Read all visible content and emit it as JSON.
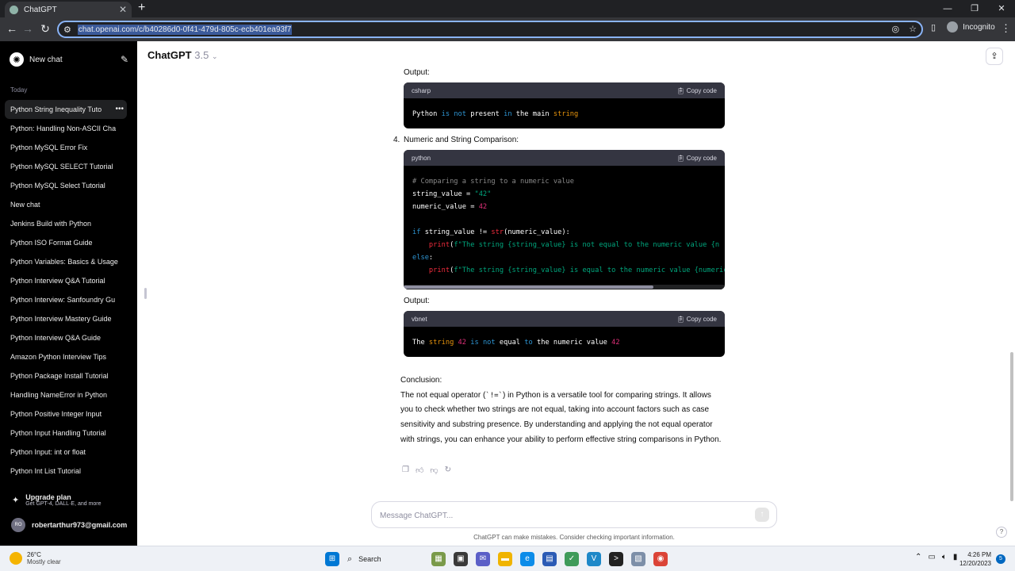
{
  "browser": {
    "tab_title": "ChatGPT",
    "url": "chat.openai.com/c/b40286d0-0f41-479d-805c-ecb401ea93f7",
    "incognito_label": "Incognito"
  },
  "sidebar": {
    "new_chat_label": "New chat",
    "section_today": "Today",
    "items": [
      "Python String Inequality Tuto",
      "Python: Handling Non-ASCII Cha",
      "Python MySQL Error Fix",
      "Python MySQL SELECT Tutorial",
      "Python MySQL Select Tutorial",
      "New chat",
      "Jenkins Build with Python",
      "Python ISO Format Guide",
      "Python Variables: Basics & Usage",
      "Python Interview Q&A Tutorial",
      "Python Interview: Sanfoundry Gu",
      "Python Interview Mastery Guide",
      "Python Interview Q&A Guide",
      "Amazon Python Interview Tips",
      "Python Package Install Tutorial",
      "Handling NameError in Python",
      "Python Positive Integer Input",
      "Python Input Handling Tutorial",
      "Python Input: int or float",
      "Python Int List Tutorial"
    ],
    "upgrade_title": "Upgrade plan",
    "upgrade_sub": "Get GPT-4, DALL·E, and more",
    "user_initials": "RO",
    "user_email": "robertarthur973@gmail.com"
  },
  "header": {
    "model": "ChatGPT",
    "version": "3.5"
  },
  "content": {
    "output_label_1": "Output:",
    "block1_lang": "csharp",
    "copy_code": "Copy code",
    "item4_num": "4.",
    "item4_title": "Numeric and String Comparison:",
    "block2_lang": "python",
    "output_label_2": "Output:",
    "block3_lang": "vbnet",
    "conclusion_title": "Conclusion:",
    "conclusion_pre": "The not equal operator (",
    "conclusion_code": "`!=`",
    "conclusion_post": ") in Python is a versatile tool for comparing strings. It allows you to check whether two strings are not equal, taking into account factors such as case sensitivity and substring presence. By understanding and applying the not equal operator with strings, you can enhance your ability to perform effective string comparisons in Python."
  },
  "composer": {
    "placeholder": "Message ChatGPT...",
    "disclaimer": "ChatGPT can make mistakes. Consider checking important information."
  },
  "taskbar": {
    "temp": "26°C",
    "weather": "Mostly clear",
    "search": "Search",
    "time": "4:26 PM",
    "date": "12/20/2023",
    "notifications": "5"
  }
}
